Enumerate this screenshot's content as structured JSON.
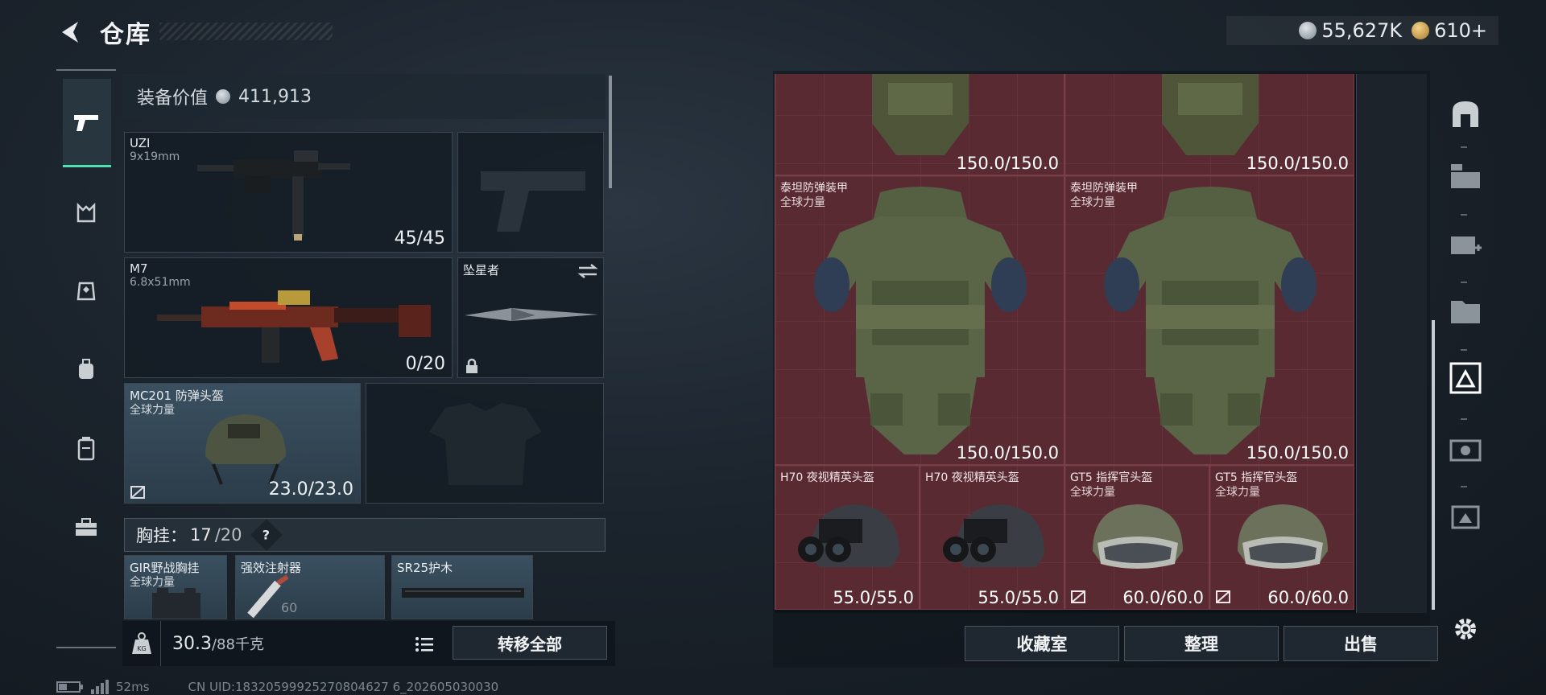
{
  "header": {
    "title": "仓库",
    "currency_silver": "55,627K",
    "currency_gold": "610+"
  },
  "left_nav": {
    "items": [
      "pistol-icon",
      "armor-icon",
      "rig-icon",
      "backpack-icon",
      "case-icon",
      "toolbox-icon"
    ]
  },
  "loadout": {
    "value_label": "装备价值",
    "value": "411,913",
    "primary": {
      "name": "UZI",
      "caliber": "9x19mm",
      "ammo": "45/45"
    },
    "secondary": {
      "name": "M7",
      "caliber": "6.8x51mm",
      "ammo": "0/20"
    },
    "melee": {
      "name": "坠星者"
    },
    "helmet": {
      "name": "MC201 防弹头盔",
      "faction": "全球力量",
      "durability": "23.0/23.0"
    },
    "vest_header": {
      "label": "胸挂：",
      "used": "17",
      "capacity": "/20",
      "help": "?"
    },
    "rig_items": [
      {
        "name": "GIR野战胸挂",
        "faction": "全球力量"
      },
      {
        "name": "强效注射器",
        "count": "60"
      },
      {
        "name": "SR25护木"
      }
    ],
    "weight": "30.3",
    "weight_max": "/88千克",
    "weight_icon": "KG",
    "transfer_all": "转移全部"
  },
  "storage": {
    "items": [
      {
        "name": "",
        "faction": "",
        "durability": "150.0/150.0"
      },
      {
        "name": "",
        "faction": "",
        "durability": "150.0/150.0"
      },
      {
        "name": "泰坦防弹装甲",
        "faction": "全球力量",
        "durability": "150.0/150.0"
      },
      {
        "name": "泰坦防弹装甲",
        "faction": "全球力量",
        "durability": "150.0/150.0"
      },
      {
        "name": "H70 夜视精英头盔",
        "faction": "",
        "durability": "55.0/55.0"
      },
      {
        "name": "H70 夜视精英头盔",
        "faction": "",
        "durability": "55.0/55.0"
      },
      {
        "name": "GT5 指挥官头盔",
        "faction": "全球力量",
        "durability": "60.0/60.0"
      },
      {
        "name": "GT5 指挥官头盔",
        "faction": "全球力量",
        "durability": "60.0/60.0"
      }
    ],
    "buttons": {
      "collection": "收藏室",
      "sort": "整理",
      "sell": "出售"
    }
  },
  "right_sidebar": {
    "items": [
      "exit-icon",
      "gti-container-icon",
      "iv-add-icon",
      "iv-folder-icon",
      "gti-selected-icon",
      "v-camera-icon",
      "iv-pouch-icon",
      "settings-icon"
    ]
  },
  "status": {
    "ping": "52ms",
    "uid": "CN UID:18320599925270804627 6_202605030030"
  },
  "colors": {
    "accent": "#4fe0b4",
    "storage_cell": "#5a2a33"
  }
}
